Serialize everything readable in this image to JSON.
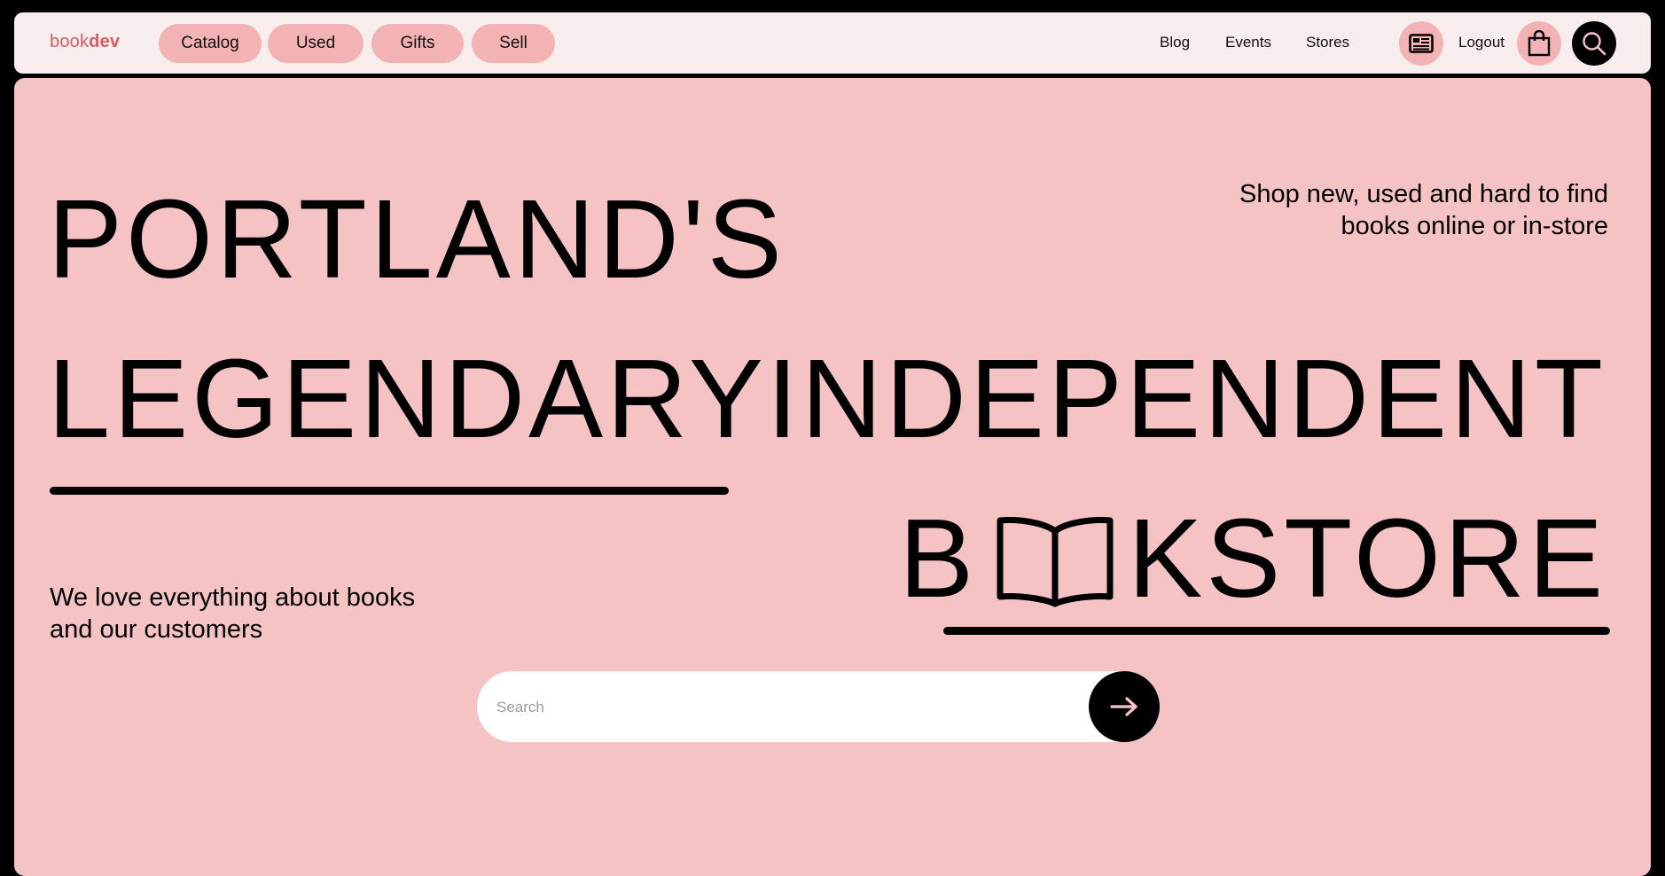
{
  "brand": {
    "logo_part1": "book",
    "logo_part2": "dev",
    "color": "#d95a63"
  },
  "nav": {
    "pills": [
      "Catalog",
      "Used",
      "Gifts",
      "Sell"
    ],
    "links": [
      "Blog",
      "Events",
      "Stores"
    ],
    "logout": "Logout",
    "icons": [
      "newspaper-icon",
      "shopping-bag-icon",
      "search-icon"
    ]
  },
  "hero": {
    "line1": "PORTLAND'S",
    "line2a": "LEGENDARY",
    "line2b": "INDEPENDENT",
    "line3a": "B",
    "line3b": "KSTORE",
    "book_icon": "open-book-icon",
    "tagline_right": [
      "Shop new, used and hard to find",
      "books online or in-store"
    ],
    "tagline_left": [
      "We love everything about books",
      "and our customers"
    ]
  },
  "search": {
    "placeholder": "Search",
    "submit_icon": "arrow-right-icon"
  },
  "colors": {
    "background": "#000000",
    "header": "#f8eded",
    "hero": "#f6c3c5",
    "pill": "#f3b3b5",
    "arrow": "#f6c3c5"
  }
}
